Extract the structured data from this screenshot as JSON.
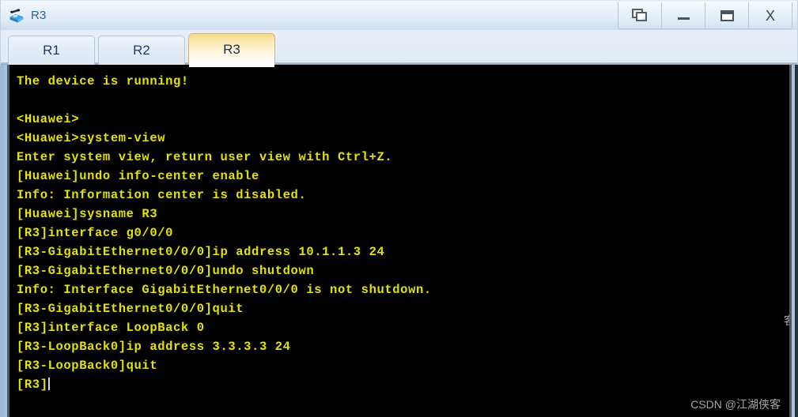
{
  "window": {
    "title": "R3",
    "icon": "router-icon",
    "controls": [
      {
        "name": "cascade-windows-button",
        "icon": "cascade-icon",
        "label": ""
      },
      {
        "name": "minimize-button",
        "icon": "minimize-icon",
        "label": ""
      },
      {
        "name": "maximize-button",
        "icon": "maximize-icon",
        "label": ""
      },
      {
        "name": "close-button",
        "icon": "close-icon",
        "label": "X"
      }
    ]
  },
  "tabs": [
    {
      "label": "R1",
      "active": false
    },
    {
      "label": "R2",
      "active": false
    },
    {
      "label": "R3",
      "active": true
    }
  ],
  "terminal": {
    "foreground_color": "#e4e400",
    "background_color": "#000000",
    "lines": [
      "The device is running!",
      "",
      "<Huawei>",
      "<Huawei>system-view",
      "Enter system view, return user view with Ctrl+Z.",
      "[Huawei]undo info-center enable",
      "Info: Information center is disabled.",
      "[Huawei]sysname R3",
      "[R3]interface g0/0/0",
      "[R3-GigabitEthernet0/0/0]ip address 10.1.1.3 24",
      "[R3-GigabitEthernet0/0/0]undo shutdown",
      "Info: Interface GigabitEthernet0/0/0 is not shutdown.",
      "[R3-GigabitEthernet0/0/0]quit",
      "[R3]interface LoopBack 0",
      "[R3-LoopBack0]ip address 3.3.3.3 24",
      "[R3-LoopBack0]quit"
    ],
    "prompt": "[R3]"
  },
  "watermarks": {
    "main": "CSDN @江湖侠客",
    "edge": "客"
  }
}
